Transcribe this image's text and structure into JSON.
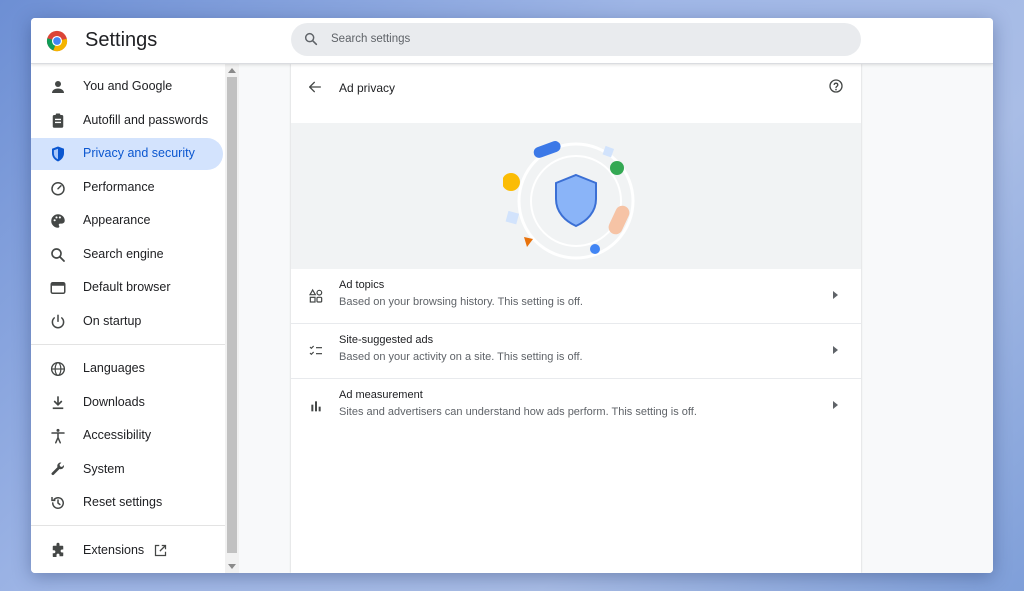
{
  "header": {
    "title": "Settings",
    "search_placeholder": "Search settings"
  },
  "sidebar": {
    "items": [
      {
        "label": "You and Google",
        "icon": "person-icon"
      },
      {
        "label": "Autofill and passwords",
        "icon": "clipboard-icon"
      },
      {
        "label": "Privacy and security",
        "icon": "shield-icon",
        "active": true
      },
      {
        "label": "Performance",
        "icon": "speedometer-icon"
      },
      {
        "label": "Appearance",
        "icon": "palette-icon"
      },
      {
        "label": "Search engine",
        "icon": "search-icon"
      },
      {
        "label": "Default browser",
        "icon": "browser-icon"
      },
      {
        "label": "On startup",
        "icon": "power-icon"
      },
      {
        "label": "Languages",
        "icon": "globe-icon"
      },
      {
        "label": "Downloads",
        "icon": "download-icon"
      },
      {
        "label": "Accessibility",
        "icon": "accessibility-icon"
      },
      {
        "label": "System",
        "icon": "wrench-icon"
      },
      {
        "label": "Reset settings",
        "icon": "history-icon"
      },
      {
        "label": "Extensions",
        "icon": "puzzle-icon"
      }
    ]
  },
  "page": {
    "title": "Ad privacy",
    "rows": [
      {
        "title": "Ad topics",
        "subtitle": "Based on your browsing history. This setting is off.",
        "icon": "shapes-icon"
      },
      {
        "title": "Site-suggested ads",
        "subtitle": "Based on your activity on a site. This setting is off.",
        "icon": "checklist-icon"
      },
      {
        "title": "Ad measurement",
        "subtitle": "Sites and advertisers can understand how ads perform. This setting is off.",
        "icon": "bar-chart-icon"
      }
    ]
  },
  "colors": {
    "accent": "#0b57d0",
    "active_bg": "#d3e3fd",
    "shield": "#8ab4f8"
  }
}
